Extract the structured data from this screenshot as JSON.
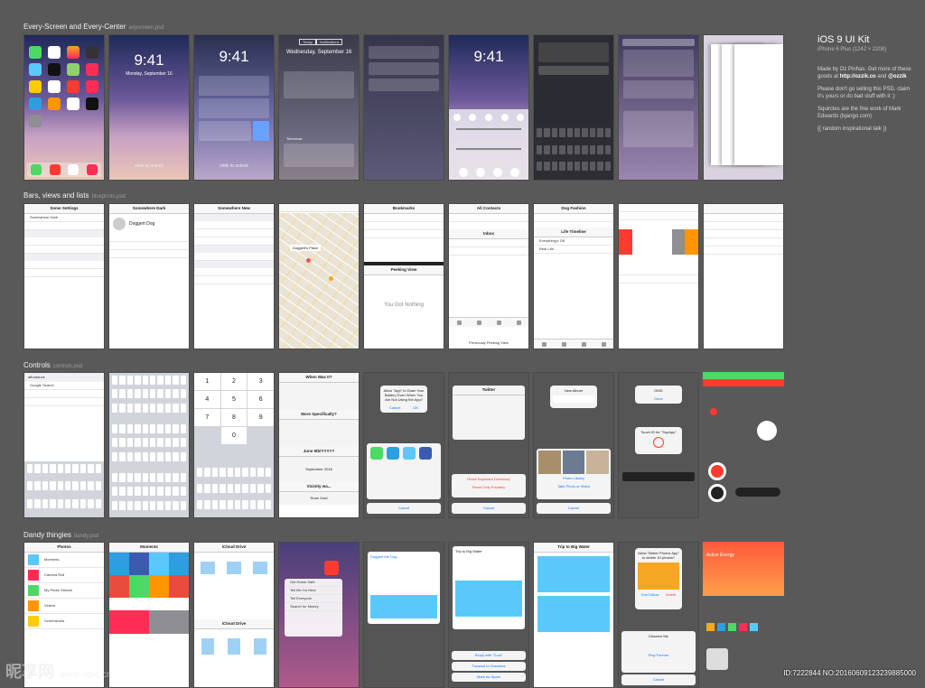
{
  "sections": [
    {
      "title": "Every-Screen and Every-Center",
      "psd": "anyscreen.psd"
    },
    {
      "title": "Bars, views and lists",
      "psd": "blueprints.psd"
    },
    {
      "title": "Controls",
      "psd": "controls.psd"
    },
    {
      "title": "Dandy thingies",
      "psd": "dandy.psd"
    }
  ],
  "lock": {
    "time": "9:41",
    "date": "Monday, September 16",
    "slide": "slide to unlock"
  },
  "nc": {
    "date": "Wednesday, September 16",
    "tabs": [
      "Today",
      "Notifications"
    ],
    "tomorrow": "Tomorrow"
  },
  "bars": {
    "settings_title": "Some Settings",
    "somewhere_dark": "Somewhere Dark",
    "somewhere_new": "Somewhere New",
    "doggert": "Doggert Dog",
    "bookmarks": "Bookmarks",
    "peeking": "Peeking View",
    "got_nothing": "You Got Nothing",
    "all_contacts": "All Contacts",
    "inbox": "Inbox",
    "dog_fashion": "Dog Fashion",
    "life_timeline": "Life Timeline",
    "everything_ok": "Everything's OK",
    "real_life": "Real Life",
    "doggert_place": "Doggert's Place",
    "previously": "Previously Peeking View"
  },
  "controls": {
    "search_value": "affordance",
    "google": "Google Search",
    "allow_app": "Allow \"App\" to Drain Your Battery Even When You Are Not Using the App?",
    "twitter": "Twitter",
    "new_album": "New Album",
    "omg": "OMG",
    "touch_id": "Touch ID for \"SupApp\"",
    "when_was_it": "When Was It?",
    "more_specifically": "More Specifically?",
    "june": "June 9th/YYYY?",
    "vicinity": "Vicinity wa...",
    "rose_gold": "Rose Gold",
    "month": "September",
    "year": "2016",
    "cancel": "Cancel",
    "done": "Done",
    "space": "space",
    "return": "return",
    "photo_library": "Photo Library",
    "take_photo": "Take Photo or Video",
    "reset_kb": "Reset Keyboard Dictionary",
    "reset_privacy": "Reset Only Privately",
    "numpad": [
      "1",
      "2",
      "3",
      "4",
      "5",
      "6",
      "7",
      "8",
      "9",
      "",
      "0",
      ""
    ]
  },
  "dandy": {
    "photos": "Photos",
    "icloud": "iCloud Drive",
    "moments": "Moments",
    "camera_roll": "Camera Roll",
    "my_photo_stream": "My Photo Stream",
    "videos": "Videos",
    "screenshots": "Screenshots",
    "get_home": "Get Home Safe",
    "tell_me": "Tell Me I'm Here",
    "tell_everyone": "Tell Everyone",
    "search_money": "Search for Money",
    "trip": "Trip to Big Water",
    "doggert_the_dog": "Doggert the Dog",
    "reply": "Reply with \"Cool\"",
    "forward": "Forward to Grandma",
    "mark_spam": "Mark As Spam",
    "allow_better": "Allow \"Better Photos App\" to delete 10 photos?",
    "dont_allow": "Don't Allow",
    "delete": "Delete",
    "dissolve": "Dissolve Me",
    "play_forever": "Play Forever",
    "active_energy": "Active Energy",
    "wednesday": "Wednesday, May 9",
    "cancel": "Cancel"
  },
  "colors": {
    "tile_colors": [
      "#2d9ee0",
      "#3b5bb0",
      "#f5a623",
      "#e94c3d",
      "#4cd964",
      "#ff9500",
      "#8e8e93",
      "#ff2d55",
      "#5ac8fa",
      "#ffcc00"
    ],
    "accent_blue": "#0a7aff",
    "red": "#ff3b30",
    "green": "#4cd964"
  },
  "side": {
    "title": "iOS 9 UI Kit",
    "subtitle": "iPhone 6 Plus (1242 × 2208)",
    "made_by": "Made by Oz Pinhas. Get more of these goods at",
    "site": "http://ozzik.co",
    "and": "and",
    "handle": "@ozzik",
    "please": "Please don't go selling this PSD, claim it's yours or do bad stuff with it :)",
    "squircles": "Squircles are the fine work of Mark Edwards (bjango.com)",
    "random": "{{ random inspirational talk }}"
  },
  "watermark": {
    "brand": "昵享网",
    "url": "www.nipic.cn",
    "id": "ID:7222844 NO:20160609123239885000"
  }
}
